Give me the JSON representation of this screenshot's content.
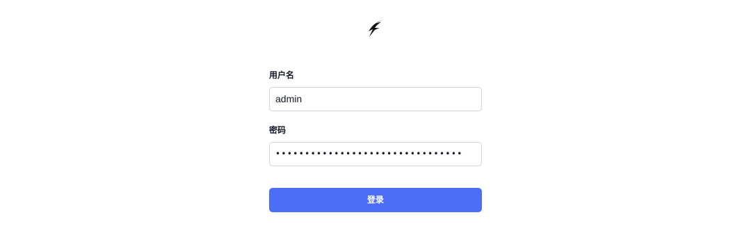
{
  "logo": {
    "icon": "bird-icon"
  },
  "form": {
    "username_label": "用户名",
    "username_value": "admin",
    "password_label": "密码",
    "password_value": "••••••••••••••••••••••••••••••••",
    "login_label": "登录"
  },
  "colors": {
    "accent": "#4c6ef5",
    "border": "#d1d5db",
    "text": "#111827"
  }
}
